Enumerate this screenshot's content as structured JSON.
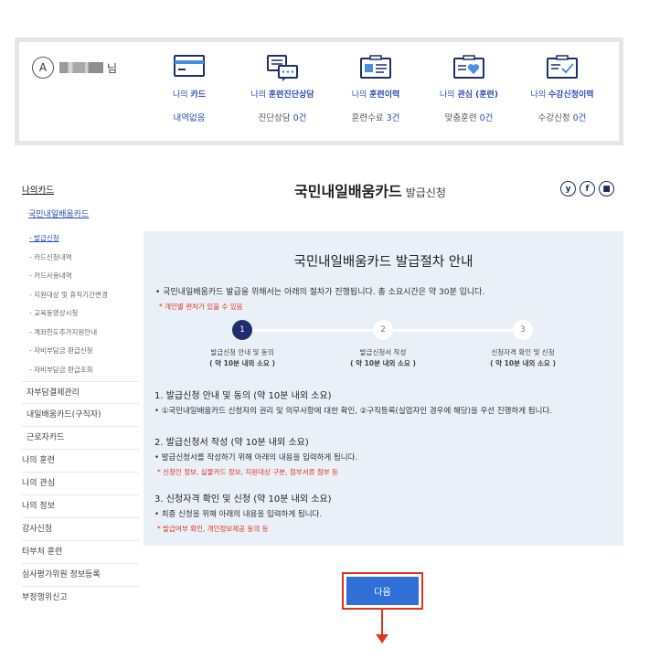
{
  "user": {
    "suffix": "님"
  },
  "summary": [
    {
      "icon": "card-icon",
      "title_prefix": "나의",
      "title": "카드",
      "value_prefix": "내역없음",
      "value_num": "",
      "value_suffix": ""
    },
    {
      "icon": "consult-chat-icon",
      "title_prefix": "나의",
      "title": "훈련진단상담",
      "value_prefix": "진단상담",
      "value_num": "0건",
      "value_suffix": ""
    },
    {
      "icon": "history-list-icon",
      "title_prefix": "나의",
      "title": "훈련이력",
      "value_prefix": "훈련수료",
      "value_num": "3건",
      "value_suffix": ""
    },
    {
      "icon": "heart-folder-icon",
      "title_prefix": "나의",
      "title": "관심 (훈련)",
      "value_prefix": "맞춤훈련",
      "value_num": "0건",
      "value_suffix": ""
    },
    {
      "icon": "check-folder-icon",
      "title_prefix": "나의",
      "title": "수강신청이력",
      "value_prefix": "수강신청",
      "value_num": "0건",
      "value_suffix": ""
    }
  ],
  "sidebar": {
    "main": "나의카드",
    "sub": "국민내일배움카드",
    "sub_items": [
      "- 발급신청",
      "- 카드신청내역",
      "- 카드사용내역",
      "- 지원대상 및 휴직기간변경",
      "- 교육동영상시청",
      "- 계좌한도추가지원안내",
      "- 자비부담금 환급신청",
      "- 자비부담금 환급조회"
    ],
    "items": [
      "자부담결제관리",
      "내일배움카드(구직자)",
      "근로자카드",
      "나의 훈련",
      "나의 관심",
      "나의 정보",
      "강사신청",
      "타부처 훈련",
      "심사평가위원 정보등록",
      "부정행위신고"
    ]
  },
  "page": {
    "title": "국민내일배움카드",
    "title_small": "발급신청"
  },
  "share": [
    "y",
    "f",
    "■"
  ],
  "procedure": {
    "title": "국민내일배움카드 발급절차 안내",
    "desc": "• 국민내일배움카드 발급을 위해서는 아래의 절차가 진행됩니다. 총 소요시간은 약 30분 입니다.",
    "note": "* 개인별 편차가 있을 수 있음",
    "steps": [
      {
        "num": "1",
        "label": "발급신청 안내 및 동의",
        "time": "( 약 10분 내외 소요 )"
      },
      {
        "num": "2",
        "label": "발급신청서 작성",
        "time": "( 약 10분 내외 소요 )"
      },
      {
        "num": "3",
        "label": "신청자격 확인 및 신청",
        "time": "( 약 10분 내외 소요 )"
      }
    ],
    "sections": [
      {
        "heading": "1. 발급신청 안내 및 동의 (약 10분 내외 소요)",
        "text": "• ①국민내일배움카드 신청자의 권리 및 의무사항에 대한 확인, ②구직등록(실업자인 경우에 해당)을 우선 진행하게 됩니다.",
        "note": ""
      },
      {
        "heading": "2. 발급신청서 작성 (약 10분 내외 소요)",
        "text": "• 발급신청서를 작성하기 위해 아래의 내용을 입력하게 됩니다.",
        "note": "* 신청인 정보, 실물카드 정보, 지원대상 구분, 첨부서류 첨부 등"
      },
      {
        "heading": "3. 신청자격 확인 및 신청 (약 10분 내외 소요)",
        "text": "• 최종 신청을 위해 아래의 내용을 입력하게 됩니다.",
        "note": "* 발급여부 확인, 개인정보제공 동의 등"
      }
    ]
  },
  "next_button": "다음",
  "colors": {
    "accent": "#2a4fb5",
    "button": "#2f6fd6",
    "highlight": "#e0341f",
    "panel": "#eaf0f8",
    "step_active": "#1f2e6e"
  }
}
